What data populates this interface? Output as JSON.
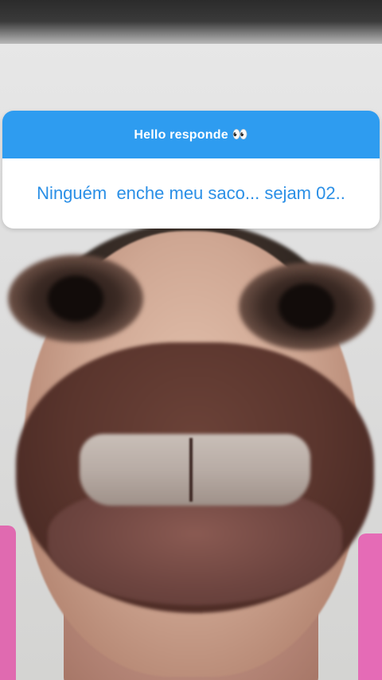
{
  "question_sticker": {
    "prompt": "Hello responde 👀",
    "answer": "Ninguém  enche meu saco... sejam 02..",
    "header_color": "#2e9cf0",
    "answer_color": "#2a8fe6"
  },
  "background": {
    "strap_color": "#e56bb6"
  }
}
